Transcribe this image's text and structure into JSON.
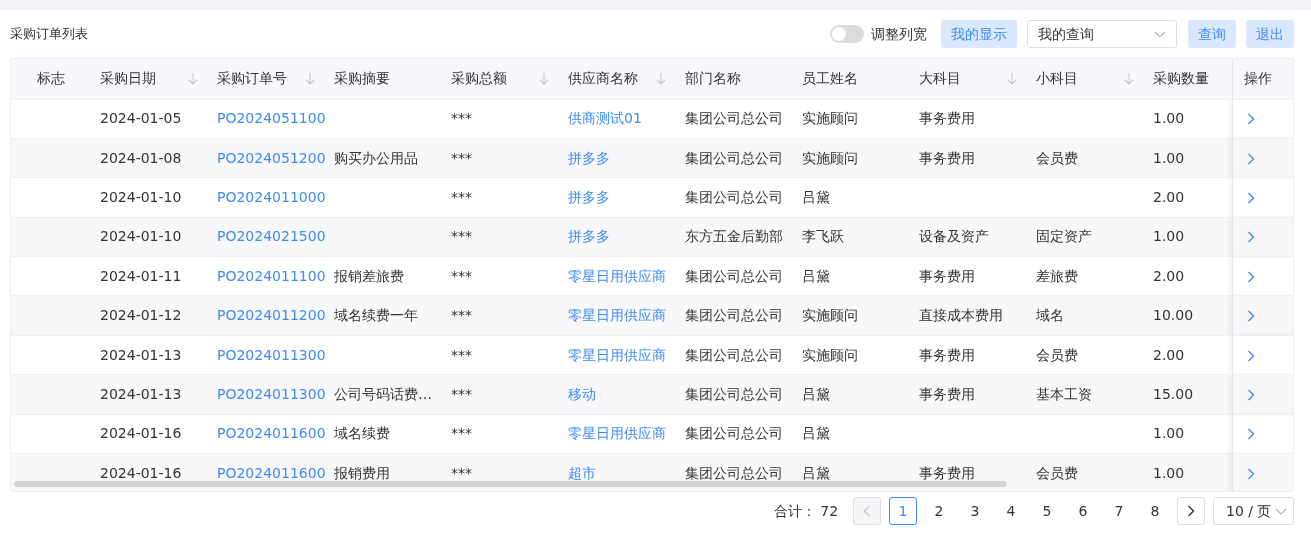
{
  "title": "采购订单列表",
  "toolbar": {
    "toggle": {
      "label": "调整列宽",
      "on": false
    },
    "display_button": "我的显示",
    "query_select": {
      "value": "我的查询"
    },
    "buttons": [
      "查询",
      "退出"
    ]
  },
  "table": {
    "columns": [
      {
        "label": "标志",
        "sortable": false
      },
      {
        "label": "采购日期",
        "sortable": true
      },
      {
        "label": "采购订单号",
        "sortable": true
      },
      {
        "label": "采购摘要",
        "sortable": false
      },
      {
        "label": "采购总额",
        "sortable": true
      },
      {
        "label": "供应商名称",
        "sortable": true
      },
      {
        "label": "部门名称",
        "sortable": false
      },
      {
        "label": "员工姓名",
        "sortable": false
      },
      {
        "label": "大科目",
        "sortable": true
      },
      {
        "label": "小科目",
        "sortable": true
      },
      {
        "label": "采购数量",
        "sortable": false
      },
      {
        "label": "操作",
        "sortable": false
      }
    ],
    "rows": [
      [
        "",
        "2024-01-05",
        "PO2024051100",
        "",
        "***",
        "供商测试01",
        "集团公司总公司",
        "实施顾问",
        "事务费用",
        "",
        "1.00"
      ],
      [
        "",
        "2024-01-08",
        "PO2024051200",
        "购买办公用品",
        "***",
        "拼多多",
        "集团公司总公司",
        "实施顾问",
        "事务费用",
        "会员费",
        "1.00"
      ],
      [
        "",
        "2024-01-10",
        "PO2024011000",
        "",
        "***",
        "拼多多",
        "集团公司总公司",
        "吕黛",
        "",
        "",
        "2.00"
      ],
      [
        "",
        "2024-01-10",
        "PO2024021500",
        "",
        "***",
        "拼多多",
        "东方五金后勤部",
        "李飞跃",
        "设备及资产",
        "固定资产",
        "1.00"
      ],
      [
        "",
        "2024-01-11",
        "PO2024011100",
        "报销差旅费",
        "***",
        "零星日用供应商",
        "集团公司总公司",
        "吕黛",
        "事务费用",
        "差旅费",
        "2.00"
      ],
      [
        "",
        "2024-01-12",
        "PO2024011200",
        "域名续费一年",
        "***",
        "零星日用供应商",
        "集团公司总公司",
        "实施顾问",
        "直接成本费用",
        "域名",
        "10.00"
      ],
      [
        "",
        "2024-01-13",
        "PO2024011300",
        "",
        "***",
        "零星日用供应商",
        "集团公司总公司",
        "实施顾问",
        "事务费用",
        "会员费",
        "2.00"
      ],
      [
        "",
        "2024-01-13",
        "PO2024011300",
        "公司号码话费…",
        "***",
        "移动",
        "集团公司总公司",
        "吕黛",
        "事务费用",
        "基本工资",
        "15.00"
      ],
      [
        "",
        "2024-01-16",
        "PO2024011600",
        "域名续费",
        "***",
        "零星日用供应商",
        "集团公司总公司",
        "吕黛",
        "",
        "",
        "1.00"
      ],
      [
        "",
        "2024-01-16",
        "PO2024011600",
        "报销费用",
        "***",
        "超市",
        "集团公司总公司",
        "吕黛",
        "事务费用",
        "会员费",
        "1.00"
      ]
    ]
  },
  "pagination": {
    "total_label": "合计：",
    "total": "72",
    "prev_disabled": true,
    "pages": [
      {
        "label": "1",
        "selected": true
      },
      {
        "label": "2",
        "selected": false
      },
      {
        "label": "3",
        "selected": false
      },
      {
        "label": "4",
        "selected": false
      },
      {
        "label": "5",
        "selected": false
      },
      {
        "label": "6",
        "selected": false
      },
      {
        "label": "7",
        "selected": false
      },
      {
        "label": "8",
        "selected": false
      }
    ],
    "page_size": "10 / 页"
  }
}
